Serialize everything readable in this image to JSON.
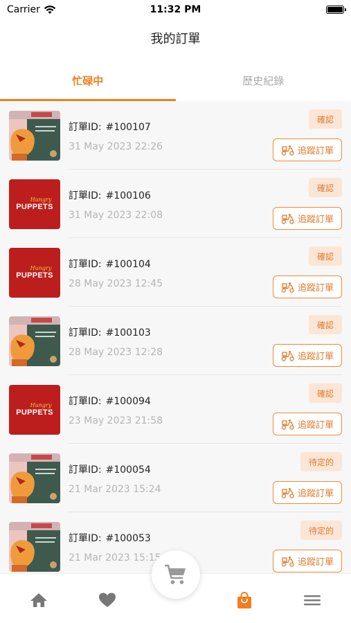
{
  "status_bar": {
    "carrier": "Carrier",
    "time": "11:32 PM"
  },
  "header": {
    "title": "我的訂單"
  },
  "tabs": [
    {
      "label": "忙碌中",
      "active": true
    },
    {
      "label": "歷史紀錄",
      "active": false
    }
  ],
  "id_label": "訂單ID:",
  "track_label": "追蹤訂單",
  "orders": [
    {
      "id": "#100107",
      "date": "31 May 2023  22:26",
      "status": "確認",
      "thumb": "comic"
    },
    {
      "id": "#100106",
      "date": "31 May 2023  22:08",
      "status": "確認",
      "thumb": "puppets"
    },
    {
      "id": "#100104",
      "date": "28 May 2023  12:45",
      "status": "確認",
      "thumb": "puppets"
    },
    {
      "id": "#100103",
      "date": "28 May 2023  12:28",
      "status": "確認",
      "thumb": "comic"
    },
    {
      "id": "#100094",
      "date": "23 May 2023  21:58",
      "status": "確認",
      "thumb": "puppets"
    },
    {
      "id": "#100054",
      "date": "21 Mar 2023  15:24",
      "status": "待定的",
      "thumb": "comic"
    },
    {
      "id": "#100053",
      "date": "21 Mar 2023  15:15",
      "status": "待定的",
      "thumb": "comic"
    }
  ],
  "thumbs": {
    "puppets_top": "Hungry",
    "puppets_main": "PUPPETS"
  },
  "bottom_nav": [
    {
      "icon": "home-icon"
    },
    {
      "icon": "heart-icon"
    },
    {
      "icon": "cart-icon"
    },
    {
      "icon": "bag-icon",
      "active": true
    },
    {
      "icon": "menu-icon"
    }
  ],
  "colors": {
    "accent": "#f07f1e",
    "badge_bg": "#fbe6d6",
    "puppets_red": "#bc1e1e"
  }
}
